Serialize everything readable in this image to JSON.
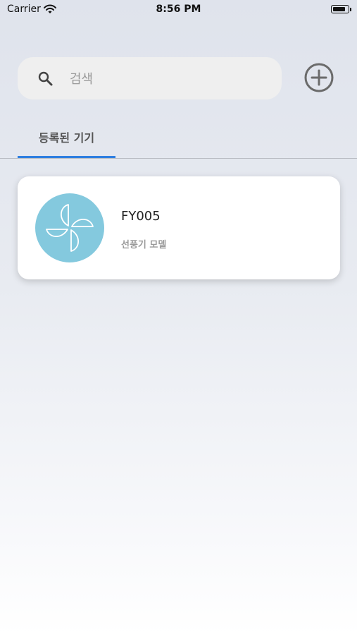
{
  "status_bar": {
    "carrier": "Carrier",
    "time": "8:56 PM",
    "battery_level": 0.85
  },
  "search": {
    "placeholder": "검색",
    "value": ""
  },
  "tabs": [
    {
      "label": "등록된 기기",
      "active": true
    }
  ],
  "devices": [
    {
      "name": "FY005",
      "model": "선풍기 모델",
      "icon": "fan-icon",
      "avatar_color": "#84c9de"
    }
  ],
  "colors": {
    "accent": "#2f7fe0",
    "icon_gray": "#6b6b6b"
  }
}
